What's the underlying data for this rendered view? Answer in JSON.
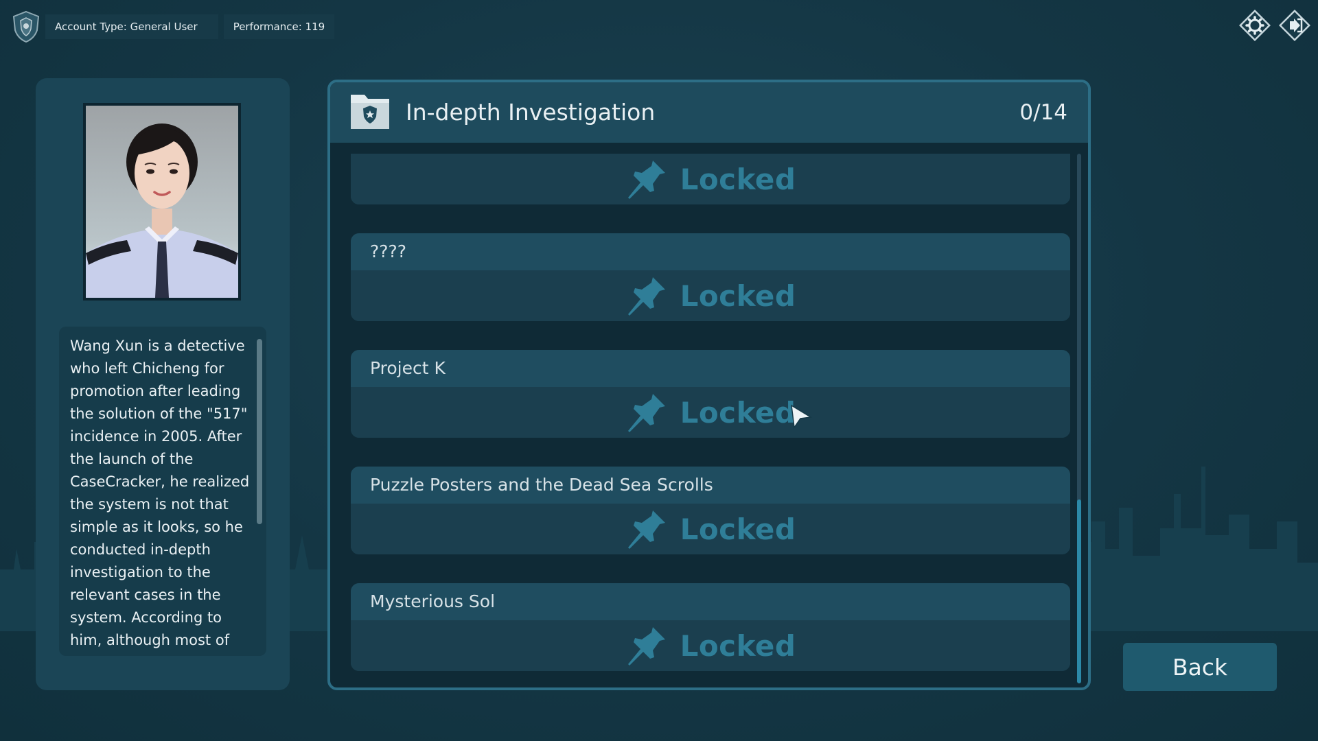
{
  "topbar": {
    "account_type": "Account Type: General User",
    "performance": "Performance: 119"
  },
  "profile": {
    "bio": "Wang Xun is a detective who left Chicheng for promotion after leading the solution of the \"517\" incidence in 2005. After the launch of the CaseCracker, he realized the system is not that simple as it looks, so he conducted in-depth investigation to the relevant cases in the system. According to him, although most of"
  },
  "panel": {
    "title": "In-depth Investigation",
    "progress": "0/14"
  },
  "cases": [
    {
      "title": "",
      "status": "Locked"
    },
    {
      "title": "????",
      "status": "Locked"
    },
    {
      "title": "Project K",
      "status": "Locked"
    },
    {
      "title": "Puzzle Posters and the Dead Sea Scrolls",
      "status": "Locked"
    },
    {
      "title": "Mysterious Sol",
      "status": "Locked"
    }
  ],
  "back_label": "Back",
  "colors": {
    "accent": "#2f7e98",
    "panel_border": "#2d6e86",
    "background": "#143644"
  },
  "icons": {
    "logo": "police-badge-icon",
    "settings": "gear-icon",
    "exit": "exit-icon",
    "folder": "folder-badge-icon",
    "pin": "pushpin-icon"
  }
}
